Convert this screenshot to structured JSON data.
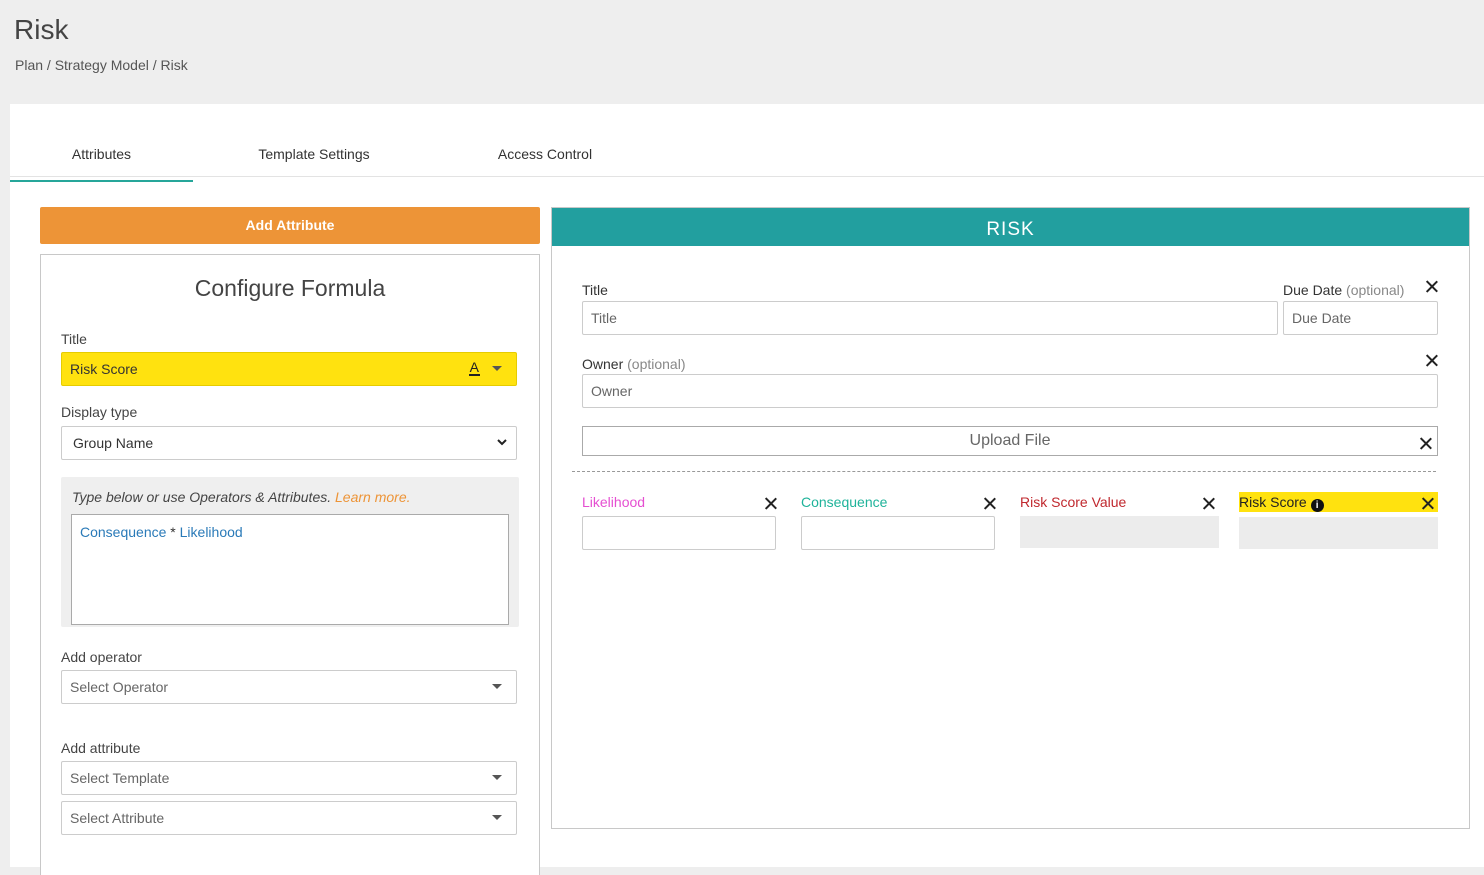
{
  "header": {
    "title": "Risk",
    "breadcrumb": "Plan / Strategy Model / Risk"
  },
  "tabs": [
    {
      "label": "Attributes",
      "active": true
    },
    {
      "label": "Template Settings",
      "active": false
    },
    {
      "label": "Access Control",
      "active": false
    }
  ],
  "add_attribute_label": "Add Attribute",
  "config": {
    "title": "Configure Formula",
    "title_label": "Title",
    "title_value": "Risk Score",
    "font_color_glyph": "A",
    "display_type_label": "Display type",
    "display_type_value": "Group Name",
    "hint": "Type below or use Operators & Attributes.",
    "learn_more": "Learn more.",
    "formula": {
      "token1": "Consequence",
      "operator": "*",
      "token2": "Likelihood"
    },
    "add_operator_label": "Add operator",
    "operator_placeholder": "Select Operator",
    "add_attribute_label": "Add attribute",
    "template_placeholder": "Select Template",
    "attribute_placeholder": "Select Attribute"
  },
  "risk": {
    "header": "RISK",
    "title_label": "Title",
    "title_placeholder": "Title",
    "due_date_label": "Due Date",
    "optional": "(optional)",
    "due_date_placeholder": "Due Date",
    "owner_label": "Owner",
    "owner_placeholder": "Owner",
    "upload_label": "Upload File",
    "attributes": [
      {
        "label": "Likelihood",
        "color": "#e54fd1"
      },
      {
        "label": "Consequence",
        "color": "#1fb39a"
      },
      {
        "label": "Risk Score Value",
        "color": "#c0282e"
      },
      {
        "label": "Risk Score",
        "color": "#222222",
        "highlight": "#ffe20f"
      }
    ]
  }
}
